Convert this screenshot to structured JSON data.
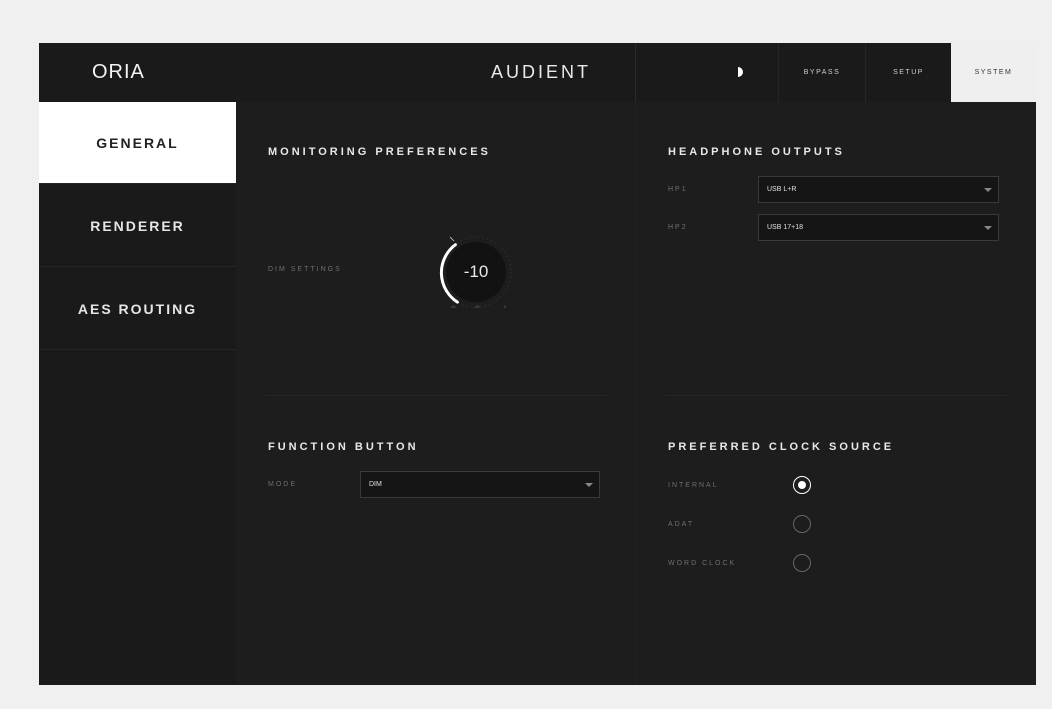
{
  "header": {
    "logo": "ORIA",
    "brand": "AUDIENT",
    "buttons": {
      "bypass": "BYPASS",
      "setup": "SETUP",
      "system": "SYSTEM"
    }
  },
  "sidebar": {
    "items": [
      {
        "label": "GENERAL",
        "active": true
      },
      {
        "label": "RENDERER",
        "active": false
      },
      {
        "label": "AES ROUTING",
        "active": false
      }
    ]
  },
  "monitoring": {
    "title": "MONITORING PREFERENCES",
    "dim_label": "DIM SETTINGS",
    "dim_value": "-10",
    "dim_scale": [
      "-40",
      "-20",
      "0"
    ]
  },
  "headphones": {
    "title": "HEADPHONE OUTPUTS",
    "hp1_label": "HP1",
    "hp1_value": "USB L+R",
    "hp2_label": "HP2",
    "hp2_value": "USB 17+18"
  },
  "function_button": {
    "title": "FUNCTION BUTTON",
    "mode_label": "MODE",
    "mode_value": "DIM"
  },
  "clock": {
    "title": "PREFERRED CLOCK SOURCE",
    "options": [
      {
        "label": "INTERNAL",
        "selected": true
      },
      {
        "label": "ADAT",
        "selected": false
      },
      {
        "label": "WORD CLOCK",
        "selected": false
      }
    ]
  },
  "colors": {
    "background": "#1c1c1c",
    "active_tab": "#ffffff",
    "accent": "#ffffff"
  }
}
